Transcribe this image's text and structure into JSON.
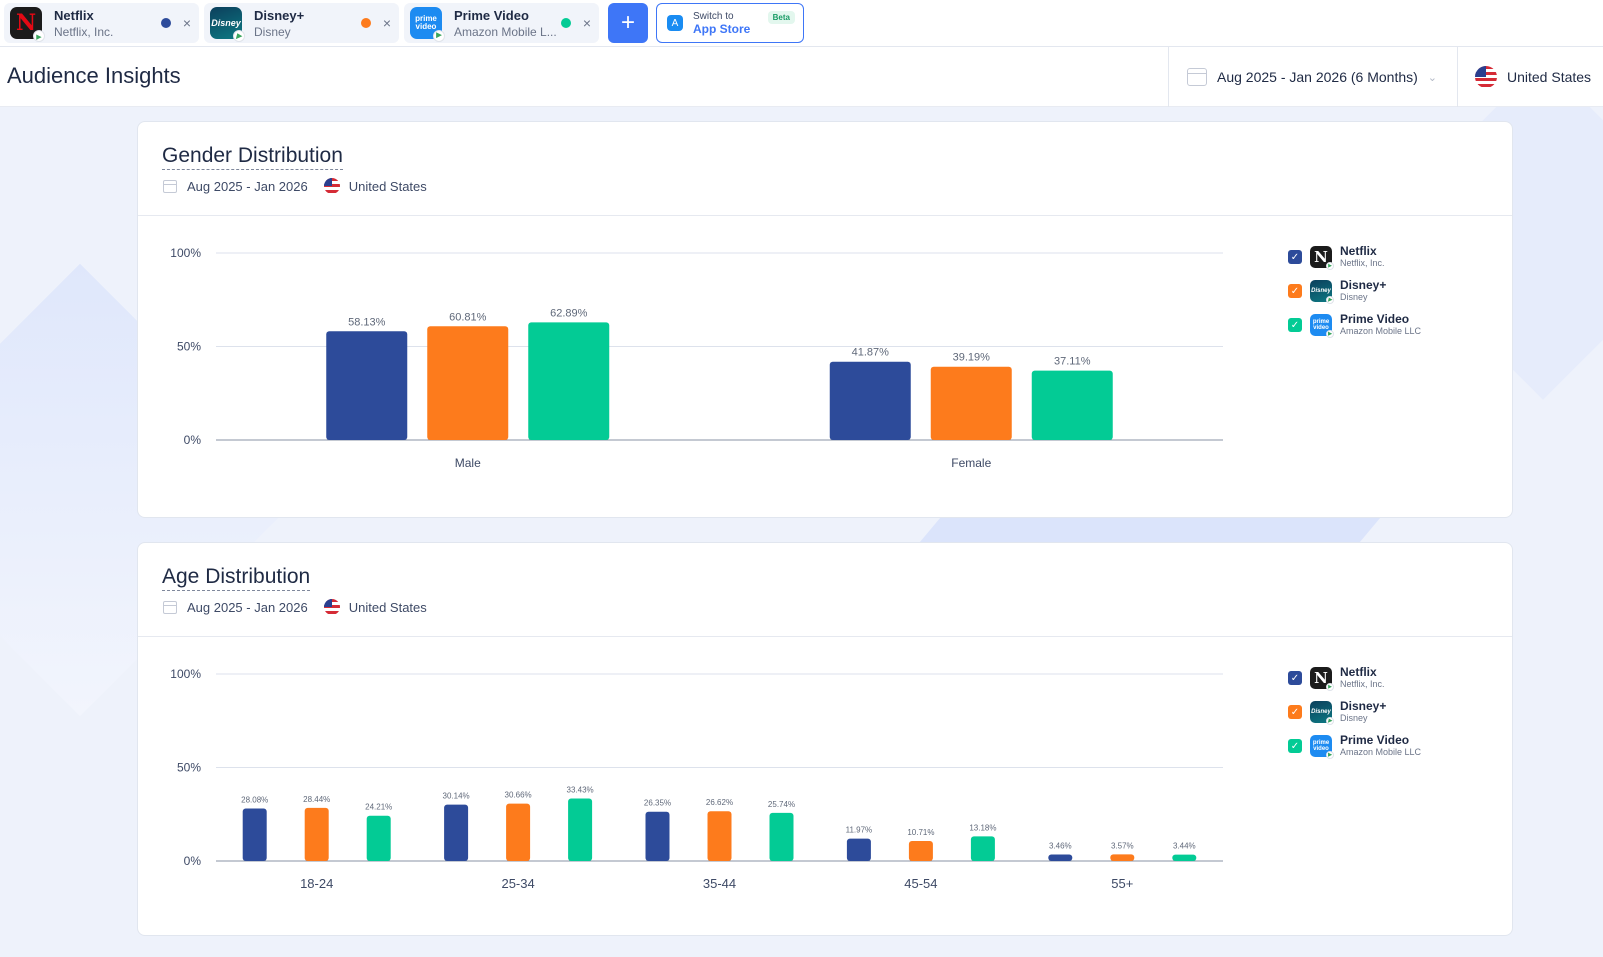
{
  "colors": {
    "netflix": "#2d4b9a",
    "disney": "#fd7b1c",
    "prime": "#03cb95",
    "accent": "#3e76f7"
  },
  "apps": [
    {
      "name": "Netflix",
      "publisher": "Netflix, Inc.",
      "legend_publisher": "Netflix, Inc.",
      "color": "#2d4b9a",
      "icon": "netflix-icon"
    },
    {
      "name": "Disney+",
      "publisher": "Disney",
      "legend_publisher": "Disney",
      "color": "#fd7b1c",
      "icon": "disney-icon"
    },
    {
      "name": "Prime Video",
      "publisher": "Amazon Mobile L...",
      "legend_publisher": "Amazon Mobile LLC",
      "color": "#03cb95",
      "icon": "prime-video-icon"
    }
  ],
  "topbar": {
    "add_label": "+",
    "switch_small": "Switch to",
    "switch_big": "App Store",
    "beta": "Beta",
    "close": "×"
  },
  "header": {
    "title": "Audience Insights",
    "date_range": "Aug 2025 - Jan 2026 (6 Months)",
    "country": "United States"
  },
  "gender": {
    "title": "Gender Distribution",
    "date": "Aug 2025 - Jan 2026",
    "country": "United States"
  },
  "age": {
    "title": "Age Distribution",
    "date": "Aug 2025 - Jan 2026",
    "country": "United States"
  },
  "chart_data": [
    {
      "type": "bar",
      "title": "Gender Distribution",
      "categories": [
        "Male",
        "Female"
      ],
      "yticks": [
        "0%",
        "50%",
        "100%"
      ],
      "ylim": [
        0,
        100
      ],
      "legend_position": "right",
      "series": [
        {
          "name": "Netflix",
          "values": [
            58.13,
            41.87
          ],
          "labels": [
            "58.13%",
            "41.87%"
          ]
        },
        {
          "name": "Disney+",
          "values": [
            60.81,
            39.19
          ],
          "labels": [
            "60.81%",
            "39.19%"
          ]
        },
        {
          "name": "Prime Video",
          "values": [
            62.89,
            37.11
          ],
          "labels": [
            "62.89%",
            "37.11%"
          ]
        }
      ]
    },
    {
      "type": "bar",
      "title": "Age Distribution",
      "categories": [
        "18-24",
        "25-34",
        "35-44",
        "45-54",
        "55+"
      ],
      "yticks": [
        "0%",
        "50%",
        "100%"
      ],
      "ylim": [
        0,
        100
      ],
      "legend_position": "right",
      "series": [
        {
          "name": "Netflix",
          "values": [
            28.08,
            30.14,
            26.35,
            11.97,
            3.46
          ],
          "labels": [
            "28.08%",
            "30.14%",
            "26.35%",
            "11.97%",
            "3.46%"
          ]
        },
        {
          "name": "Disney+",
          "values": [
            28.44,
            30.66,
            26.62,
            10.71,
            3.57
          ],
          "labels": [
            "28.44%",
            "30.66%",
            "26.62%",
            "10.71%",
            "3.57%"
          ]
        },
        {
          "name": "Prime Video",
          "values": [
            24.21,
            33.43,
            25.74,
            13.18,
            3.44
          ],
          "labels": [
            "24.21%",
            "33.43%",
            "25.74%",
            "13.18%",
            "3.44%"
          ]
        }
      ]
    }
  ]
}
